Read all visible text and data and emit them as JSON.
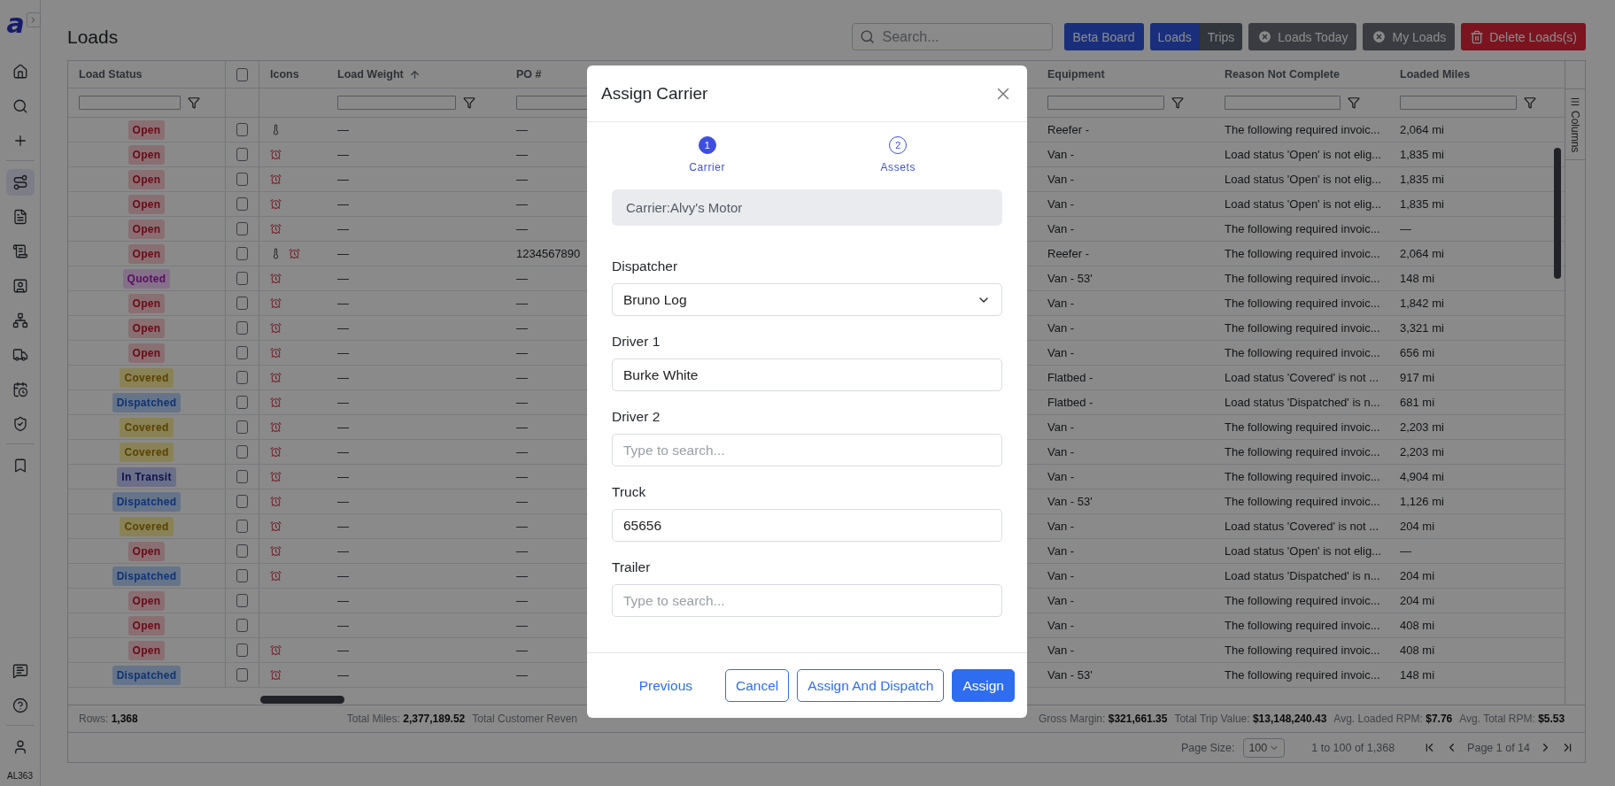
{
  "sidebar": {
    "logo": "a",
    "nav_sections": [
      {
        "items": [
          {
            "kind": "home",
            "selected": false
          },
          {
            "kind": "search",
            "selected": false
          },
          {
            "kind": "add",
            "selected": false
          }
        ]
      },
      {
        "items": [
          {
            "kind": "route",
            "selected": true
          },
          {
            "kind": "invoice",
            "selected": false
          },
          {
            "kind": "report",
            "selected": false
          },
          {
            "kind": "contact",
            "selected": false
          },
          {
            "kind": "network",
            "selected": false
          },
          {
            "kind": "truck",
            "selected": false
          },
          {
            "kind": "schedule",
            "selected": false
          },
          {
            "kind": "shield",
            "selected": false
          }
        ]
      },
      {
        "items": [
          {
            "kind": "bookmark",
            "selected": false
          }
        ]
      }
    ],
    "bottom_sections": [
      {
        "items": [
          {
            "kind": "chat",
            "selected": false
          },
          {
            "kind": "help",
            "selected": false
          }
        ]
      },
      {
        "items": [
          {
            "kind": "user",
            "selected": false
          }
        ]
      }
    ],
    "user_code": "AL363"
  },
  "page": {
    "title": "Loads"
  },
  "toolbar": {
    "search": {
      "placeholder": "Search..."
    },
    "beta_button": "Beta Board",
    "view_toggle": [
      {
        "label": "Loads",
        "selected": true
      },
      {
        "label": "Trips",
        "selected": false
      }
    ],
    "chips": [
      "Loads Today",
      "My Loads"
    ],
    "delete_button": "Delete Loads(s)"
  },
  "table": {
    "columns": [
      {
        "kind": "status",
        "label": "Load Status",
        "filter": true,
        "sort_ascending": false
      },
      {
        "kind": "checkbox",
        "checked": false
      },
      {
        "kind": "icons",
        "label": "Icons",
        "filter": false,
        "sort_ascending": false
      },
      {
        "kind": "text",
        "label": "Load Weight",
        "filter": true,
        "sort_ascending": true
      },
      {
        "kind": "text",
        "label": "PO #",
        "filter": true,
        "sort_ascending": false
      },
      {
        "kind": "text",
        "label": "Equipment",
        "filter": true,
        "sort_ascending": false
      },
      {
        "kind": "text",
        "label": "Reason Not Complete",
        "filter": true,
        "sort_ascending": false
      },
      {
        "kind": "text",
        "label": "Loaded Miles",
        "filter": true,
        "sort_ascending": false
      }
    ],
    "side_panel_tab": "Columns",
    "rows": [
      {
        "status": {
          "label": "Open",
          "kind": "open"
        },
        "checked": false,
        "thermometer": true,
        "alarm": false,
        "load_weight": "—",
        "po": "—",
        "equipment": "Reefer -",
        "reason": "The following required invoic...",
        "loaded_miles": "2,064 mi"
      },
      {
        "status": {
          "label": "Open",
          "kind": "open"
        },
        "checked": false,
        "thermometer": false,
        "alarm": true,
        "load_weight": "—",
        "po": "—",
        "equipment": "Van -",
        "reason": "Load status 'Open' is not elig...",
        "loaded_miles": "1,835 mi"
      },
      {
        "status": {
          "label": "Open",
          "kind": "open"
        },
        "checked": false,
        "thermometer": false,
        "alarm": true,
        "load_weight": "—",
        "po": "—",
        "equipment": "Van -",
        "reason": "Load status 'Open' is not elig...",
        "loaded_miles": "1,835 mi"
      },
      {
        "status": {
          "label": "Open",
          "kind": "open"
        },
        "checked": false,
        "thermometer": false,
        "alarm": true,
        "load_weight": "—",
        "po": "—",
        "equipment": "Van -",
        "reason": "Load status 'Open' is not elig...",
        "loaded_miles": "1,835 mi"
      },
      {
        "status": {
          "label": "Open",
          "kind": "open"
        },
        "checked": false,
        "thermometer": false,
        "alarm": true,
        "load_weight": "—",
        "po": "—",
        "equipment": "Van -",
        "reason": "The following required invoic...",
        "loaded_miles": "—"
      },
      {
        "status": {
          "label": "Open",
          "kind": "open"
        },
        "checked": false,
        "thermometer": true,
        "alarm": true,
        "load_weight": "—",
        "po": "1234567890",
        "equipment": "Reefer -",
        "reason": "The following required invoic...",
        "loaded_miles": "2,064 mi"
      },
      {
        "status": {
          "label": "Quoted",
          "kind": "quoted"
        },
        "checked": false,
        "thermometer": false,
        "alarm": true,
        "load_weight": "—",
        "po": "—",
        "equipment": "Van - 53'",
        "reason": "The following required invoic...",
        "loaded_miles": "148 mi"
      },
      {
        "status": {
          "label": "Open",
          "kind": "open"
        },
        "checked": false,
        "thermometer": false,
        "alarm": true,
        "load_weight": "—",
        "po": "—",
        "equipment": "Van -",
        "reason": "The following required invoic...",
        "loaded_miles": "1,842 mi"
      },
      {
        "status": {
          "label": "Open",
          "kind": "open"
        },
        "checked": false,
        "thermometer": false,
        "alarm": true,
        "load_weight": "—",
        "po": "—",
        "equipment": "Van -",
        "reason": "The following required invoic...",
        "loaded_miles": "3,321 mi"
      },
      {
        "status": {
          "label": "Open",
          "kind": "open"
        },
        "checked": false,
        "thermometer": false,
        "alarm": true,
        "load_weight": "—",
        "po": "—",
        "equipment": "Van -",
        "reason": "The following required invoic...",
        "loaded_miles": "656 mi"
      },
      {
        "status": {
          "label": "Covered",
          "kind": "covered"
        },
        "checked": false,
        "thermometer": false,
        "alarm": true,
        "load_weight": "—",
        "po": "—",
        "equipment": "Flatbed -",
        "reason": "Load status 'Covered' is not ...",
        "loaded_miles": "917 mi"
      },
      {
        "status": {
          "label": "Dispatched",
          "kind": "dispatched"
        },
        "checked": false,
        "thermometer": false,
        "alarm": true,
        "load_weight": "—",
        "po": "—",
        "equipment": "Flatbed -",
        "reason": "Load status 'Dispatched' is n...",
        "loaded_miles": "681 mi"
      },
      {
        "status": {
          "label": "Covered",
          "kind": "covered"
        },
        "checked": false,
        "thermometer": false,
        "alarm": true,
        "load_weight": "—",
        "po": "—",
        "equipment": "Van -",
        "reason": "The following required invoic...",
        "loaded_miles": "2,203 mi"
      },
      {
        "status": {
          "label": "Covered",
          "kind": "covered"
        },
        "checked": false,
        "thermometer": false,
        "alarm": true,
        "load_weight": "—",
        "po": "—",
        "equipment": "Van -",
        "reason": "The following required invoic...",
        "loaded_miles": "2,203 mi"
      },
      {
        "status": {
          "label": "In Transit",
          "kind": "in_transit"
        },
        "checked": false,
        "thermometer": false,
        "alarm": true,
        "load_weight": "—",
        "po": "—",
        "equipment": "Van -",
        "reason": "The following required invoic...",
        "loaded_miles": "4,904 mi"
      },
      {
        "status": {
          "label": "Dispatched",
          "kind": "dispatched"
        },
        "checked": false,
        "thermometer": false,
        "alarm": true,
        "load_weight": "—",
        "po": "—",
        "equipment": "Van - 53'",
        "reason": "The following required invoic...",
        "loaded_miles": "1,126 mi"
      },
      {
        "status": {
          "label": "Covered",
          "kind": "covered"
        },
        "checked": false,
        "thermometer": false,
        "alarm": true,
        "load_weight": "—",
        "po": "—",
        "equipment": "Van -",
        "reason": "Load status 'Covered' is not ...",
        "loaded_miles": "204 mi"
      },
      {
        "status": {
          "label": "Open",
          "kind": "open"
        },
        "checked": false,
        "thermometer": false,
        "alarm": true,
        "load_weight": "—",
        "po": "—",
        "equipment": "Van -",
        "reason": "Load status 'Open' is not elig...",
        "loaded_miles": "—"
      },
      {
        "status": {
          "label": "Dispatched",
          "kind": "dispatched"
        },
        "checked": false,
        "thermometer": false,
        "alarm": true,
        "load_weight": "—",
        "po": "—",
        "equipment": "Van -",
        "reason": "Load status 'Dispatched' is n...",
        "loaded_miles": "204 mi"
      },
      {
        "status": {
          "label": "Open",
          "kind": "open"
        },
        "checked": false,
        "thermometer": false,
        "alarm": false,
        "load_weight": "—",
        "po": "—",
        "equipment": "Van -",
        "reason": "The following required invoic...",
        "loaded_miles": "204 mi"
      },
      {
        "status": {
          "label": "Open",
          "kind": "open"
        },
        "checked": false,
        "thermometer": false,
        "alarm": false,
        "load_weight": "—",
        "po": "—",
        "equipment": "Van -",
        "reason": "The following required invoic...",
        "loaded_miles": "408 mi"
      },
      {
        "status": {
          "label": "Open",
          "kind": "open"
        },
        "checked": false,
        "thermometer": false,
        "alarm": true,
        "load_weight": "—",
        "po": "—",
        "equipment": "Van -",
        "reason": "The following required invoic...",
        "loaded_miles": "408 mi"
      },
      {
        "status": {
          "label": "Dispatched",
          "kind": "dispatched"
        },
        "checked": false,
        "thermometer": false,
        "alarm": true,
        "load_weight": "—",
        "po": "—",
        "equipment": "Van - 53'",
        "reason": "The following required invoic...",
        "loaded_miles": "148 mi"
      }
    ],
    "footer": {
      "rows_label": "Rows:",
      "rows_value": "1,368",
      "stats_left": [
        {
          "label": "Total Miles:",
          "value": "2,377,189.52"
        }
      ],
      "cut_label": "Total Customer Reven",
      "stats_right": [
        {
          "label": "Gross Margin:",
          "value": "$321,661.35"
        },
        {
          "label": "Total Trip Value:",
          "value": "$13,148,240.43"
        },
        {
          "label": "Avg. Loaded RPM:",
          "value": "$7.76"
        },
        {
          "label": "Avg. Total RPM:",
          "value": "$5.53"
        }
      ],
      "page_size_label": "Page Size:",
      "page_size": "100",
      "range": "1 to 100 of 1,368",
      "page": "Page 1 of 14"
    }
  },
  "modal": {
    "title": "Assign Carrier",
    "steps": [
      {
        "number": "1",
        "label": "Carrier",
        "selected": true
      },
      {
        "number": "2",
        "label": "Assets",
        "selected": false
      }
    ],
    "carrier": "Carrier:Alvy's Motor",
    "fields": [
      {
        "label": "Dispatcher",
        "kind": "select",
        "value": "Bruno Log"
      },
      {
        "label": "Driver 1",
        "kind": "input",
        "value": "Burke White"
      },
      {
        "label": "Driver 2",
        "kind": "input",
        "placeholder": "Type to search..."
      },
      {
        "label": "Truck",
        "kind": "input",
        "value": "65656"
      },
      {
        "label": "Trailer",
        "kind": "input",
        "placeholder": "Type to search..."
      }
    ],
    "buttons": [
      {
        "label": "Previous",
        "kind": "link"
      },
      {
        "label": "Cancel",
        "kind": "outline"
      },
      {
        "label": "Assign And Dispatch",
        "kind": "outline"
      },
      {
        "label": "Assign",
        "kind": "primary"
      }
    ]
  }
}
